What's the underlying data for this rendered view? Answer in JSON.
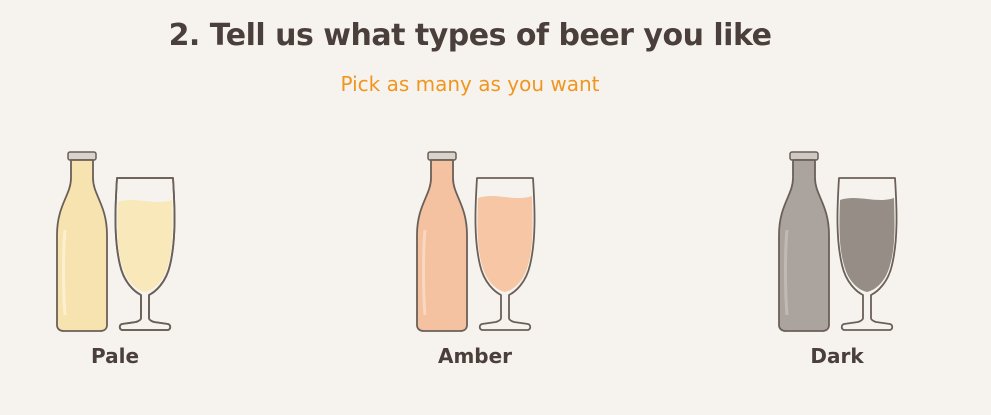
{
  "heading": "2. Tell us what types of beer you like",
  "subheading": "Pick as many as you want",
  "options": [
    {
      "label": "Pale",
      "fill": "#f7e3b0",
      "liquid": "#f8e7b6",
      "outline": "#6b6058"
    },
    {
      "label": "Amber",
      "fill": "#f4c2a1",
      "liquid": "#f5c3a0",
      "outline": "#6b6058"
    },
    {
      "label": "Dark",
      "fill": "#aaa39e",
      "liquid": "#8f8780",
      "outline": "#6b6058"
    }
  ],
  "colors": {
    "background": "#f6f3ef",
    "heading": "#4a3f3b",
    "accent": "#f0961f"
  },
  "icons": [
    "beer-bottle-icon",
    "beer-glass-icon"
  ]
}
